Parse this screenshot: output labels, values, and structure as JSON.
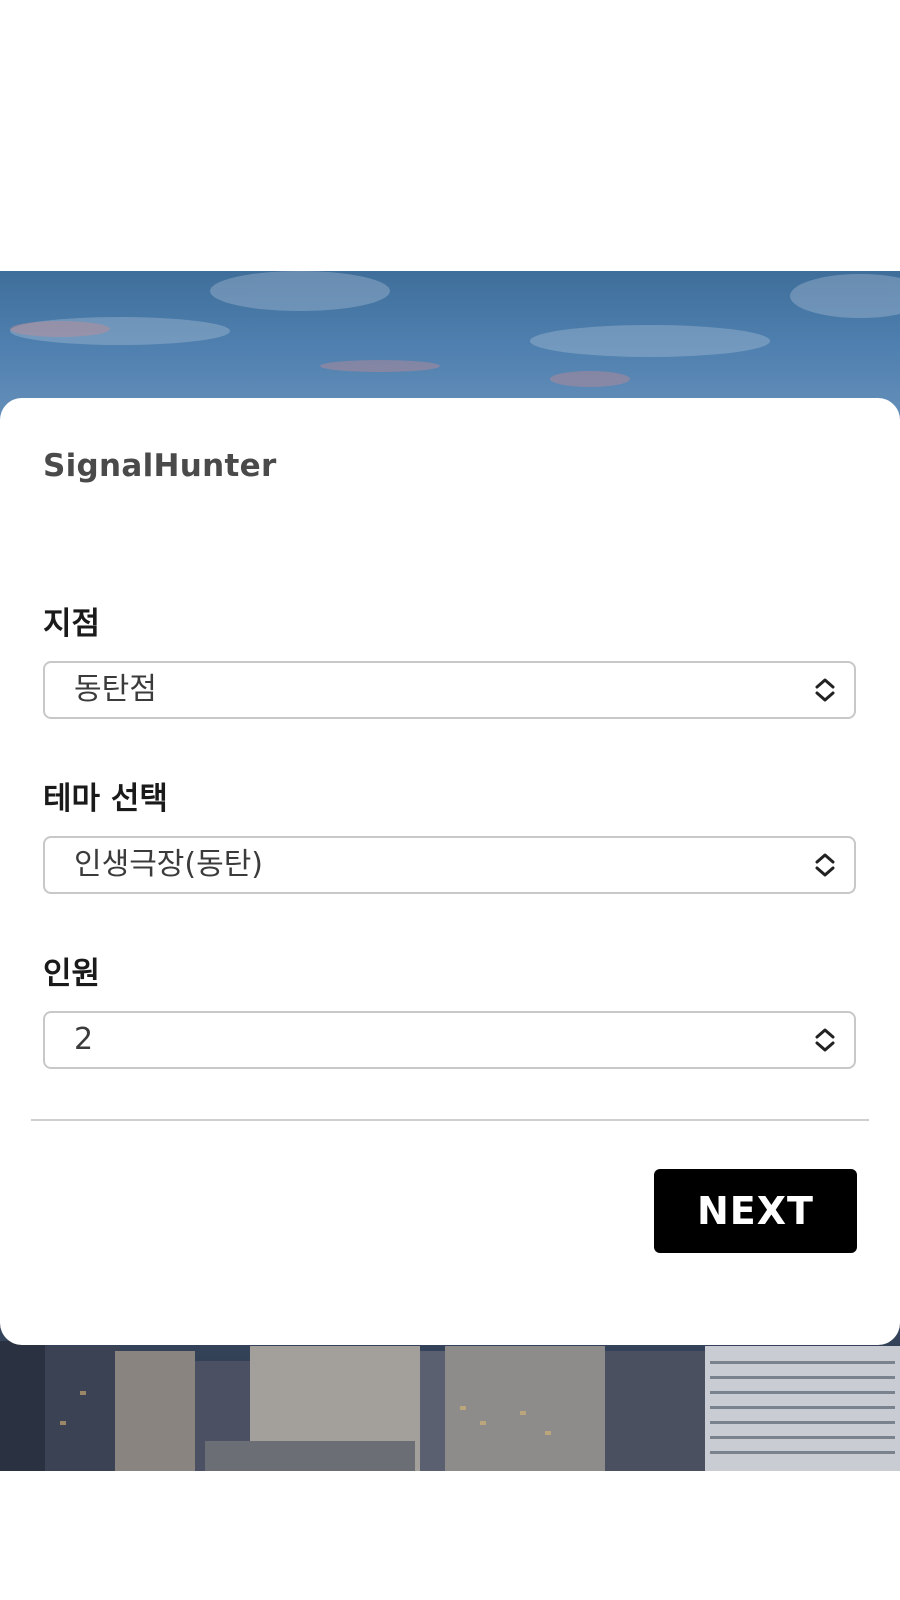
{
  "brand": {
    "name": "SignalHunter"
  },
  "form": {
    "branch": {
      "label": "지점",
      "value": "동탄점"
    },
    "theme": {
      "label": "테마 선택",
      "value": "인생극장(동탄)"
    },
    "people": {
      "label": "인원",
      "value": "2"
    }
  },
  "actions": {
    "next_label": "NEXT"
  },
  "colors": {
    "button_bg": "#000000",
    "button_text": "#ffffff",
    "label_text": "#1a1a1a",
    "select_border": "#c8c8c8"
  },
  "icons": {
    "select_indicator": "chevron-up-down-icon"
  }
}
